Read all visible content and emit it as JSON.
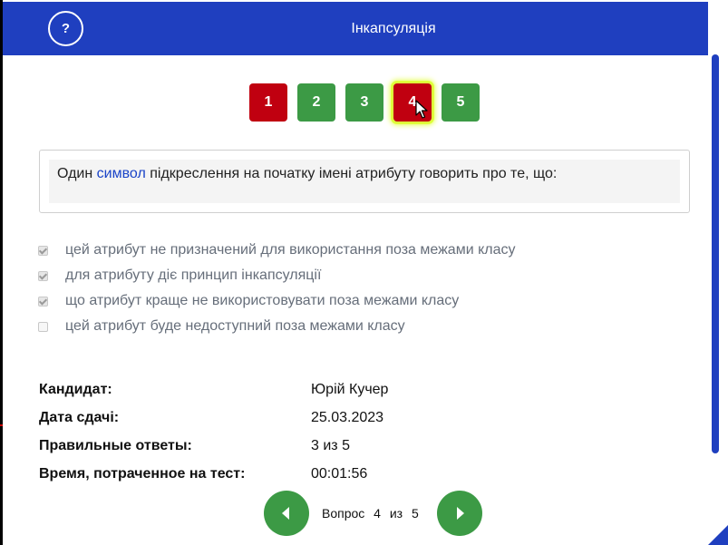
{
  "header": {
    "help_label": "?",
    "title": "Інкапсуляція"
  },
  "question_nav": [
    {
      "label": "1",
      "status": "wrong"
    },
    {
      "label": "2",
      "status": "correct"
    },
    {
      "label": "3",
      "status": "correct"
    },
    {
      "label": "4",
      "status": "wrong"
    },
    {
      "label": "5",
      "status": "correct"
    }
  ],
  "question": {
    "prefix": "Один ",
    "link_word": "символ",
    "suffix": " підкреслення на початку імені атрибуту говорить про те, що:"
  },
  "answers": [
    {
      "text": "цей атрибут не призначений для використання поза межами класу",
      "checked": true
    },
    {
      "text": "для атрибуту діє принцип інкапсуляції",
      "checked": true
    },
    {
      "text": "що атрибут краще не використовувати поза межами класу",
      "checked": true
    },
    {
      "text": "цей атрибут буде недоступний поза межами класу",
      "checked": false
    }
  ],
  "info": {
    "candidate_label": "Кандидат:",
    "candidate_value": "Юрій Кучер",
    "date_label": "Дата сдачі:",
    "date_value": "25.03.2023",
    "correct_label": "Правильные ответы:",
    "correct_value": "3 из 5",
    "time_label": "Время, потраченное на тест:",
    "time_value": "00:01:56"
  },
  "pager": {
    "word": "Вопрос",
    "current": "4",
    "of": "из",
    "total": "5"
  },
  "colors": {
    "header": "#1f3fbf",
    "wrong": "#c00010",
    "correct": "#3c9a45",
    "highlight": "#dfff3a"
  }
}
